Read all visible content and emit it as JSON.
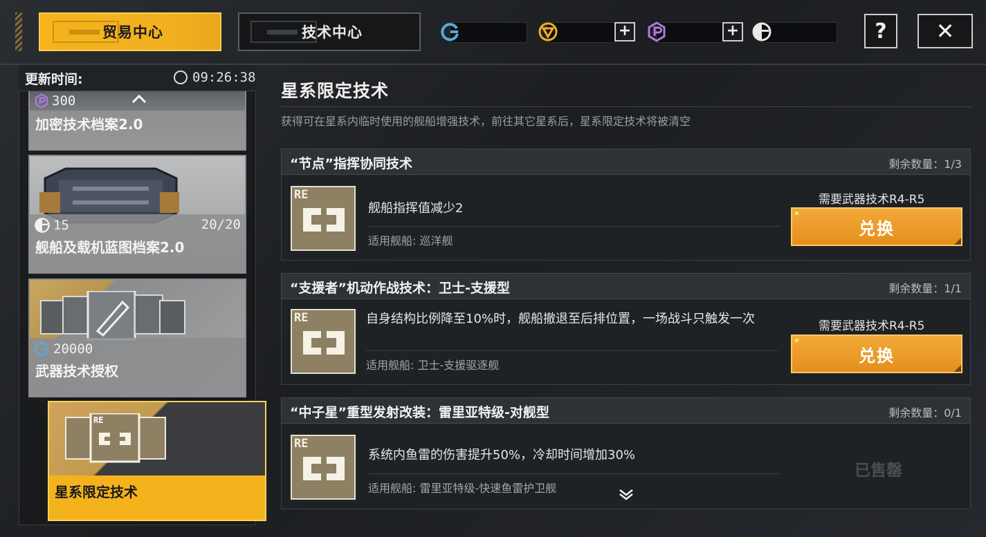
{
  "tabs": {
    "trade": "贸易中心",
    "tech": "技术中心"
  },
  "top_buttons": {
    "help": "?",
    "close": "✕"
  },
  "left": {
    "update_label": "更新时间:",
    "update_time": "09:26:38",
    "cards": [
      {
        "title": "加密技术档案2.0",
        "price": "300",
        "currency_icon": "hex-p-icon"
      },
      {
        "title": "舰船及载机蓝图档案2.0",
        "price": "15",
        "stock": "20/20",
        "currency_icon": "half-circle-icon"
      },
      {
        "title": "武器技术授权",
        "price": "20000",
        "currency_icon": "cycle-icon"
      },
      {
        "title": "星系限定技术"
      }
    ]
  },
  "main": {
    "title": "星系限定技术",
    "desc": "获得可在星系内临时使用的舰船增强技术，前往其它星系后，星系限定技术将被清空",
    "items": [
      {
        "name": "“节点”指挥协同技术",
        "remaining": "剩余数量：1/3",
        "effect": "舰船指挥值减少2",
        "ship": "适用舰船: 巡洋舰",
        "req": "需要武器技术R4-R5",
        "button": "兑换"
      },
      {
        "name": "“支援者”机动作战技术：卫士-支援型",
        "remaining": "剩余数量：1/1",
        "effect": "自身结构比例降至10%时，舰船撤退至后排位置，一场战斗只触发一次",
        "ship": "适用舰船: 卫士-支援驱逐舰",
        "req": "需要武器技术R4-R5",
        "button": "兑换"
      },
      {
        "name": "“中子星”重型发射改装：雷里亚特级-对舰型",
        "remaining": "剩余数量：0/1",
        "effect": "系统内鱼雷的伤害提升50%，冷却时间增加30%",
        "ship": "适用舰船: 雷里亚特级-快速鱼雷护卫舰",
        "sold": "已售罄"
      }
    ],
    "re_label": "RE"
  },
  "colors": {
    "accent": "#f2b021",
    "button": "#e8961f",
    "cycle": "#5aa8d8",
    "gold": "#f0b020",
    "purple": "#b07ae0"
  }
}
